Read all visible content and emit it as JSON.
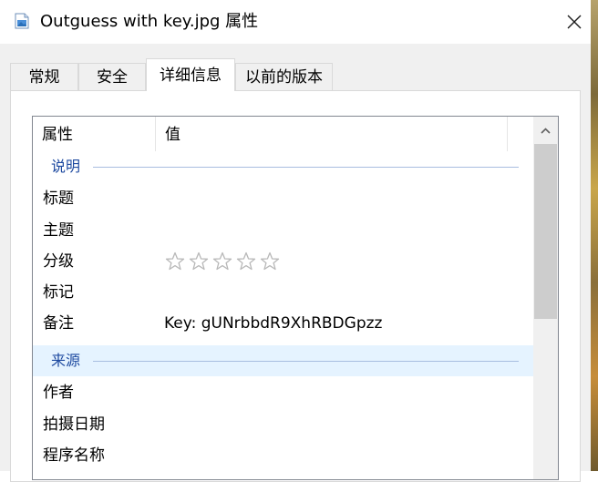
{
  "window": {
    "title": "Outguess with key.jpg 属性",
    "icon": "image-file-icon",
    "close_icon": "close-icon"
  },
  "tabs": [
    {
      "label": "常规",
      "active": false
    },
    {
      "label": "安全",
      "active": false
    },
    {
      "label": "详细信息",
      "active": true
    },
    {
      "label": "以前的版本",
      "active": false
    }
  ],
  "details": {
    "headers": {
      "property": "属性",
      "value": "值"
    },
    "groups": [
      {
        "label": "说明",
        "rows": [
          {
            "name": "标题",
            "value": ""
          },
          {
            "name": "主题",
            "value": ""
          },
          {
            "name": "分级",
            "rating": 0,
            "max_rating": 5
          },
          {
            "name": "标记",
            "value": ""
          },
          {
            "name": "备注",
            "value": "Key: gUNrbbdR9XhRBDGpzz"
          }
        ]
      },
      {
        "label": "来源",
        "selected": true,
        "rows": [
          {
            "name": "作者",
            "value": ""
          },
          {
            "name": "拍摄日期",
            "value": ""
          },
          {
            "name": "程序名称",
            "value": ""
          }
        ]
      }
    ]
  },
  "colors": {
    "group_label": "#1e4aa0",
    "selection": "#e5f3ff",
    "star_outline": "#b8b8b8"
  }
}
